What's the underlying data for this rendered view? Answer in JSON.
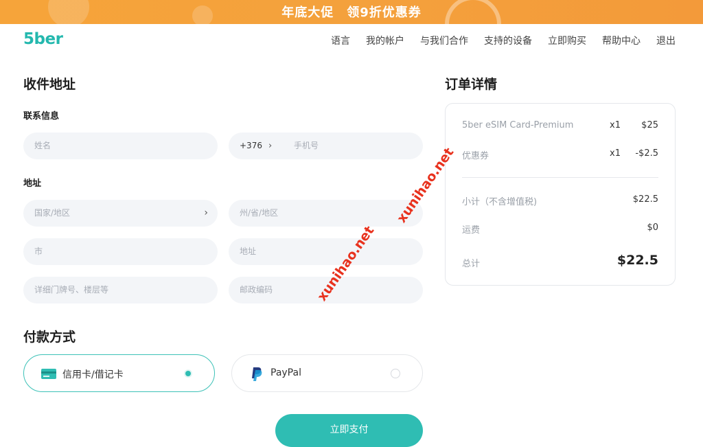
{
  "banner": {
    "text": "年底大促　领9折优惠券"
  },
  "header": {
    "logo": "5ber",
    "nav": [
      "语言",
      "我的帐户",
      "与我们合作",
      "支持的设备",
      "立即购买",
      "帮助中心",
      "退出"
    ]
  },
  "shipping": {
    "title": "收件地址",
    "contact_title": "联系信息",
    "name_placeholder": "姓名",
    "phone_code": "+376",
    "phone_placeholder": "手机号",
    "address_title": "地址",
    "country_placeholder": "国家/地区",
    "state_placeholder": "州/省/地区",
    "city_placeholder": "市",
    "address_placeholder": "地址",
    "detail_placeholder": "详细门牌号、楼层等",
    "zip_placeholder": "邮政编码"
  },
  "payment": {
    "title": "付款方式",
    "options": [
      {
        "label": "信用卡/借记卡",
        "selected": true
      },
      {
        "label": "PayPal",
        "selected": false
      }
    ],
    "submit_label": "立即支付"
  },
  "order": {
    "title": "订单详情",
    "items": [
      {
        "name": "5ber eSIM Card-Premium",
        "qty": "x1",
        "price": "$25"
      },
      {
        "name": "优惠券",
        "qty": "x1",
        "price": "-$2.5"
      }
    ],
    "subtotal_label": "小计（不含增值税)",
    "subtotal": "$22.5",
    "shipping_label": "运费",
    "shipping": "$0",
    "total_label": "总计",
    "total": "$22.5"
  },
  "watermarks": [
    "xunihao.net",
    "xunihao.net"
  ],
  "colors": {
    "accent": "#2fbdb3",
    "banner": "#f5a23b",
    "watermark": "#e8321e"
  },
  "icons": [
    "credit-card-icon",
    "paypal-icon",
    "chevron-right-icon"
  ]
}
